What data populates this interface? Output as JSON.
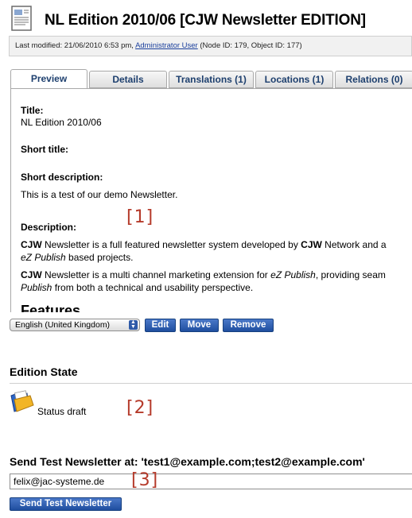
{
  "header": {
    "icon": "document-icon",
    "title": "NL Edition 2010/06 [CJW Newsletter EDITION]",
    "meta_prefix": "Last modified: 21/06/2010 6:53 pm,",
    "meta_user": "Administrator User",
    "meta_suffix": "(Node ID: 179, Object ID: 177)"
  },
  "tabs": [
    {
      "label": "Preview",
      "active": true
    },
    {
      "label": "Details",
      "active": false
    },
    {
      "label": "Translations (1)",
      "active": false
    },
    {
      "label": "Locations (1)",
      "active": false
    },
    {
      "label": "Relations (0)",
      "active": false
    }
  ],
  "preview": {
    "title_label": "Title:",
    "title_value": "NL Edition 2010/06",
    "short_title_label": "Short title:",
    "short_desc_label": "Short description:",
    "short_desc_value": "This is a test of our demo Newsletter.",
    "description_label": "Description:",
    "p1": {
      "b1": "CJW",
      "t1": " Newsletter is a full featured newsletter system developed by ",
      "b2": "CJW",
      "t2": " Network and a",
      "i1": "eZ Publish",
      "t3": " based projects."
    },
    "p2": {
      "b1": "CJW",
      "t1": " Newsletter is a multi channel marketing extension for ",
      "i1": "eZ Publish",
      "t2": ", providing seam",
      "i2": "Publish",
      "t3": " from both a technical and usability perspective."
    },
    "next_heading": "Features"
  },
  "callouts": {
    "c1": "[1]",
    "c2": "[2]",
    "c3": "[3]"
  },
  "controls": {
    "language": "English (United Kingdom)",
    "edit": "Edit",
    "move": "Move",
    "remove": "Remove"
  },
  "edition_state": {
    "heading": "Edition State",
    "icon": "open-folder-icon",
    "status": "Status draft"
  },
  "send_test": {
    "heading": "Send Test Newsletter at: 'test1@example.com;test2@example.com'",
    "input_value": "felix@jac-systeme.de",
    "button": "Send Test Newsletter"
  },
  "colors": {
    "accent_button": "#2a5aa8",
    "tab_text": "#1d3f6e",
    "callout": "#b53a2a",
    "link": "#1a3f9c"
  }
}
